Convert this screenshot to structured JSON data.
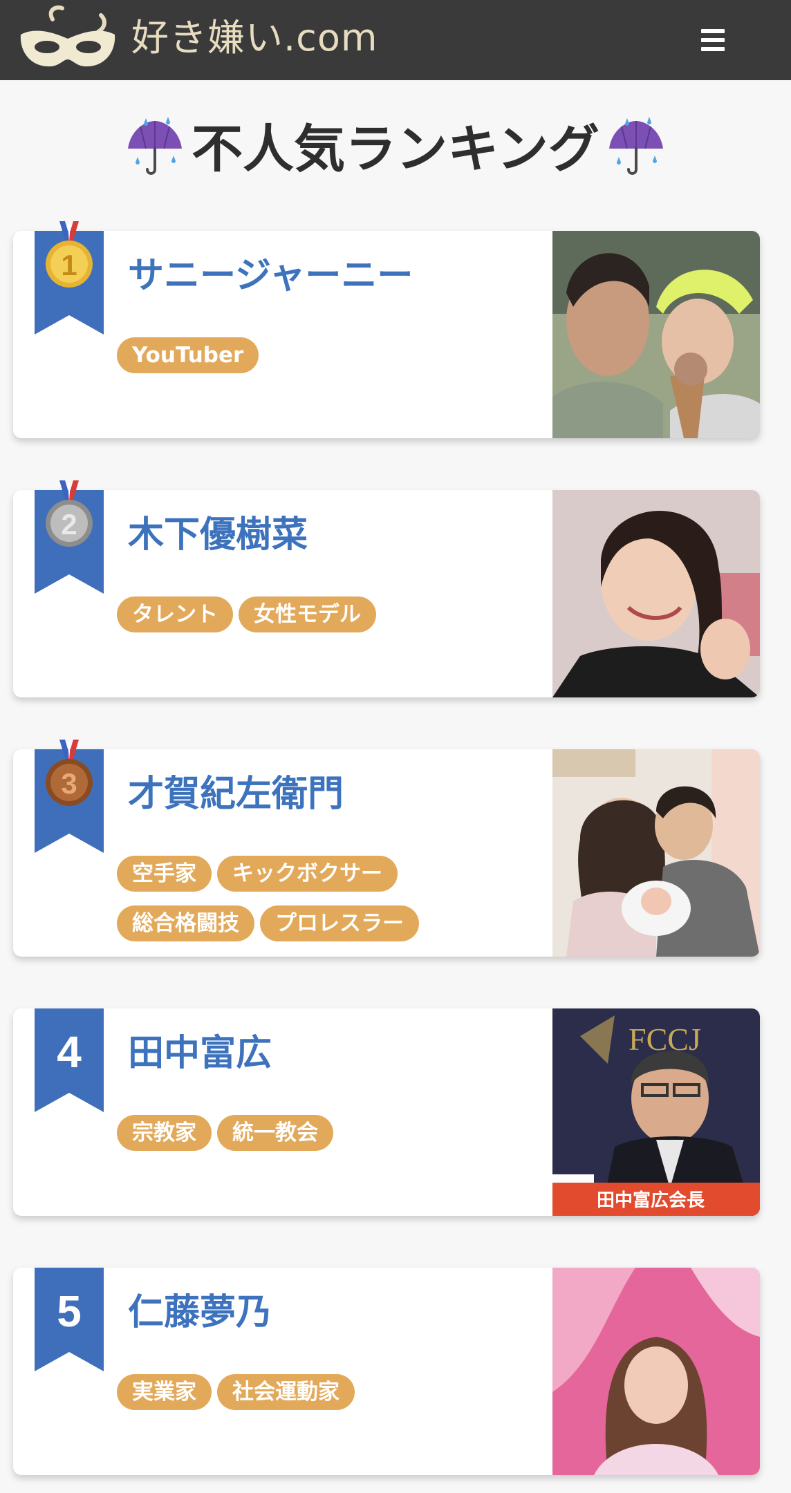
{
  "header": {
    "site_title": "好き嫌い.com",
    "logo_icon": "mask-logo-icon",
    "menu_icon": "hamburger-menu-icon"
  },
  "page": {
    "heading": "不人気ランキング",
    "heading_icon": "umbrella-with-rain-icon"
  },
  "colors": {
    "header_bg": "#3a3a3a",
    "name_blue": "#3d72bd",
    "ribbon_blue": "#3f6fba",
    "tag_orange": "#e3a95a",
    "medal_gold": "#d9a52c",
    "medal_silver": "#9a9a9a",
    "medal_bronze": "#9b5a2e"
  },
  "ranking": [
    {
      "rank": "1",
      "medal": "gold-medal-icon",
      "name": "サニージャーニー",
      "tags": [
        "YouTuber"
      ]
    },
    {
      "rank": "2",
      "medal": "silver-medal-icon",
      "name": "木下優樹菜",
      "tags": [
        "タレント",
        "女性モデル"
      ]
    },
    {
      "rank": "3",
      "medal": "bronze-medal-icon",
      "name": "才賀紀左衛門",
      "tags": [
        "空手家",
        "キックボクサー",
        "総合格闘技",
        "プロレスラー"
      ]
    },
    {
      "rank": "4",
      "name": "田中富広",
      "tags": [
        "宗教家",
        "統一教会"
      ],
      "photo_caption": "田中富広会長"
    },
    {
      "rank": "5",
      "name": "仁藤夢乃",
      "tags": [
        "実業家",
        "社会運動家"
      ]
    }
  ]
}
